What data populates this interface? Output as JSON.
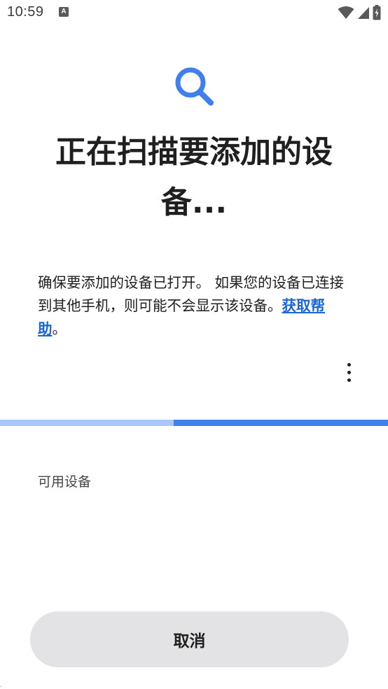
{
  "status_bar": {
    "time": "10:59",
    "notification_icon": "a-letter-notification-icon",
    "icons": [
      "wifi-icon",
      "cellular-signal-icon",
      "battery-charging-icon"
    ]
  },
  "header": {
    "icon": "search-icon",
    "icon_color": "#3f7fee",
    "title": "正在扫描要添加的设备..."
  },
  "description": {
    "text": "确保要添加的设备已打开。 如果您的设备已连接到其他手机，则可能不会显示该设备。",
    "help_link": "获取帮助",
    "trailing": "。",
    "link_color": "#1a66d2"
  },
  "menu": {
    "icon": "more-vert-icon"
  },
  "progress": {
    "type": "indeterminate",
    "track_color": "#aac7fb",
    "indicator_color": "#3f7fee"
  },
  "devices_section": {
    "header": "可用设备",
    "items": []
  },
  "footer": {
    "cancel_label": "取消"
  }
}
